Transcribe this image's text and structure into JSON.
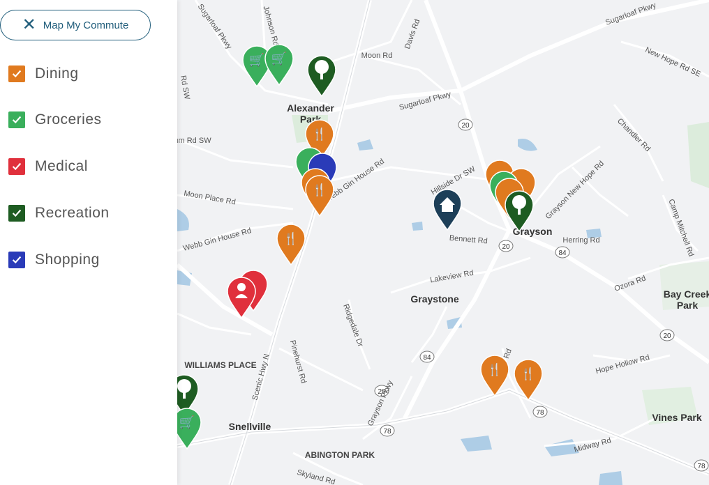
{
  "sidebar": {
    "commute_button": {
      "icon": "close-icon",
      "label": "Map My Commute"
    },
    "categories": [
      {
        "label": "Dining",
        "color": "#e07a1f",
        "checked": true
      },
      {
        "label": "Groceries",
        "color": "#3aaf5c",
        "checked": true
      },
      {
        "label": "Medical",
        "color": "#e0303c",
        "checked": true
      },
      {
        "label": "Recreation",
        "color": "#1e5c22",
        "checked": true
      },
      {
        "label": "Shopping",
        "color": "#2a3bb8",
        "checked": true
      }
    ]
  },
  "map": {
    "place_labels": [
      "Alexander",
      "Park",
      "Grayson",
      "Graystone",
      "Bay Creek",
      "Park",
      "Vines Park",
      "Snellville",
      "WILLIAMS PLACE",
      "ABINGTON PARK"
    ],
    "road_labels": [
      "Sugarloaf Pkwy",
      "Johnson Rd",
      "Davis Rd",
      "Moon Rd",
      "Sugarloaf Pkwy",
      "Sugarloaf Pkwy",
      "New Hope Rd SE",
      "Rd SW",
      "um Rd SW",
      "Moon Place Rd",
      "Webb Gin House Rd",
      "Webb Gin House Rd",
      "Hillside Dr SW",
      "Bennett Rd",
      "Grayson New Hope Rd",
      "Chandler Rd",
      "Camp Mitchell Rd",
      "Herring Rd",
      "Ozora Rd",
      "Lakeview Rd",
      "Ridgedale Dr",
      "Pinehurst Rd",
      "Scenic Hwy N",
      "Grayson Pkwy",
      "Cooper Rd",
      "Hope Hollow Rd",
      "Midway Rd",
      "Skyland Rd"
    ],
    "route_shields": [
      "20",
      "20",
      "84",
      "20",
      "84",
      "20",
      "78",
      "78",
      "78"
    ]
  }
}
